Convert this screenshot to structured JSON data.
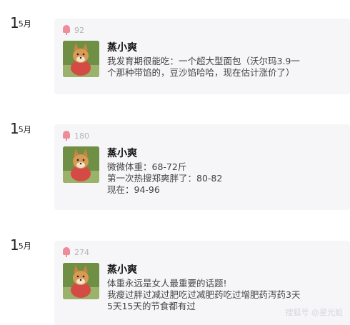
{
  "posts": [
    {
      "date_day": "1",
      "date_month": "5月",
      "count": "92",
      "author": "蒸小爽",
      "lines": [
        "我发育期很能吃：一个超大型面包（沃尔玛3.9一",
        "个那种带馅的，豆沙馅哈哈，现在估计涨价了）"
      ]
    },
    {
      "date_day": "1",
      "date_month": "5月",
      "count": "180",
      "author": "蒸小爽",
      "lines": [
        "微微体重：68-72斤",
        "第一次热搜郑爽胖了：80-82",
        "现在：94-96"
      ]
    },
    {
      "date_day": "1",
      "date_month": "5月",
      "count": "274",
      "author": "蒸小爽",
      "lines": [
        "体重永远是女人最重要的话题!",
        "我瘦过胖过减过肥吃过减肥药吃过增肥药泻药3天",
        "5天15天的节食都有过"
      ]
    }
  ],
  "watermark": "搜狐号 @星光姐",
  "colors": {
    "card_bg": "#f6f6f8",
    "popsicle": "#ee8c99",
    "count": "#b5b5b5"
  },
  "icons": {
    "count_icon": "popsicle-icon"
  }
}
